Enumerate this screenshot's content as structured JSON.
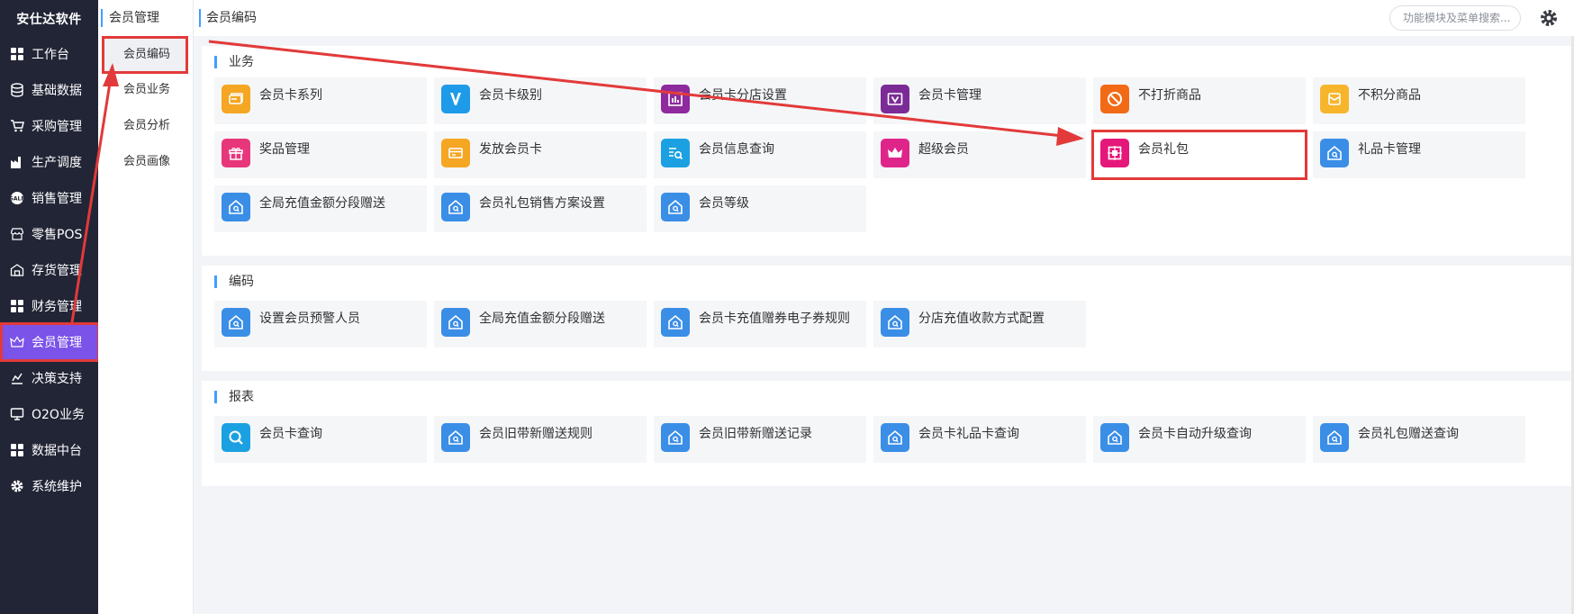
{
  "app": {
    "brand": "安仕达软件"
  },
  "sidebar": {
    "items": [
      {
        "label": "工作台",
        "icon": "grid-icon"
      },
      {
        "label": "基础数据",
        "icon": "database-icon"
      },
      {
        "label": "采购管理",
        "icon": "cart-icon"
      },
      {
        "label": "生产调度",
        "icon": "factory-icon"
      },
      {
        "label": "销售管理",
        "icon": "sale-badge-icon"
      },
      {
        "label": "零售POS",
        "icon": "store-icon"
      },
      {
        "label": "存货管理",
        "icon": "warehouse-icon"
      },
      {
        "label": "财务管理",
        "icon": "grid-icon"
      },
      {
        "label": "会员管理",
        "icon": "crown-icon"
      },
      {
        "label": "决策支持",
        "icon": "chart-icon"
      },
      {
        "label": "O2O业务",
        "icon": "monitor-icon"
      },
      {
        "label": "数据中台",
        "icon": "grid-icon"
      },
      {
        "label": "系统维护",
        "icon": "gear-icon"
      }
    ],
    "active_index": 8
  },
  "subnav": {
    "title": "会员管理",
    "items": [
      {
        "label": "会员编码"
      },
      {
        "label": "会员业务"
      },
      {
        "label": "会员分析"
      },
      {
        "label": "会员画像"
      }
    ],
    "active_index": 0
  },
  "header": {
    "breadcrumb": "会员编码",
    "search_placeholder": "功能模块及菜单搜索..."
  },
  "sections": [
    {
      "title": "业务",
      "tiles": [
        {
          "label": "会员卡系列",
          "icon": "card-stack-icon",
          "color": "#f5a623"
        },
        {
          "label": "会员卡级别",
          "icon": "v-letter-icon",
          "color": "#1e9be8"
        },
        {
          "label": "会员卡分店设置",
          "icon": "shop-chart-icon",
          "color": "#8e2a9e"
        },
        {
          "label": "会员卡管理",
          "icon": "tv-card-icon",
          "color": "#7b2b96"
        },
        {
          "label": "不打折商品",
          "icon": "no-entry-icon",
          "color": "#f26a16"
        },
        {
          "label": "不积分商品",
          "icon": "bag-icon",
          "color": "#f7b52c"
        },
        {
          "label": "奖品管理",
          "icon": "gift-icon",
          "color": "#e8367a"
        },
        {
          "label": "发放会员卡",
          "icon": "send-card-icon",
          "color": "#f5a623"
        },
        {
          "label": "会员信息查询",
          "icon": "search-list-icon",
          "color": "#1ba1e2"
        },
        {
          "label": "超级会员",
          "icon": "crown-icon",
          "color": "#e0258a"
        },
        {
          "label": "会员礼包",
          "icon": "gift-box-icon",
          "color": "#e6177a"
        },
        {
          "label": "礼品卡管理",
          "icon": "house-search-icon",
          "color": "#3a8ee6"
        },
        {
          "label": "全局充值金额分段赠送",
          "icon": "house-search-icon",
          "color": "#3a8ee6"
        },
        {
          "label": "会员礼包销售方案设置",
          "icon": "house-search-icon",
          "color": "#3a8ee6"
        },
        {
          "label": "会员等级",
          "icon": "house-search-icon",
          "color": "#3a8ee6"
        }
      ]
    },
    {
      "title": "编码",
      "tiles": [
        {
          "label": "设置会员预警人员",
          "icon": "house-search-icon",
          "color": "#3a8ee6"
        },
        {
          "label": "全局充值金额分段赠送",
          "icon": "house-search-icon",
          "color": "#3a8ee6"
        },
        {
          "label": "会员卡充值赠券电子券规则",
          "icon": "house-search-icon",
          "color": "#3a8ee6"
        },
        {
          "label": "分店充值收款方式配置",
          "icon": "house-search-icon",
          "color": "#3a8ee6"
        }
      ]
    },
    {
      "title": "报表",
      "tiles": [
        {
          "label": "会员卡查询",
          "icon": "magnifier-icon",
          "color": "#1ba1e2"
        },
        {
          "label": "会员旧带新赠送规则",
          "icon": "house-search-icon",
          "color": "#3a8ee6"
        },
        {
          "label": "会员旧带新赠送记录",
          "icon": "house-search-icon",
          "color": "#3a8ee6"
        },
        {
          "label": "会员卡礼品卡查询",
          "icon": "house-search-icon",
          "color": "#3a8ee6"
        },
        {
          "label": "会员卡自动升级查询",
          "icon": "house-search-icon",
          "color": "#3a8ee6"
        },
        {
          "label": "会员礼包赠送查询",
          "icon": "house-search-icon",
          "color": "#3a8ee6"
        }
      ]
    }
  ],
  "colors": {
    "sidebar_bg": "#222536",
    "active_purple": "#7b53e8",
    "annotation_red": "#e23a3a",
    "accent_blue": "#409eff"
  }
}
